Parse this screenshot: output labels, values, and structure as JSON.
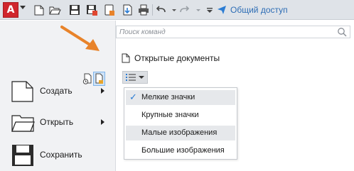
{
  "app": {
    "logo_letter": "A",
    "share_label": "Общий доступ"
  },
  "toolbar": {
    "icons": [
      "new-icon",
      "open-icon",
      "save-icon",
      "save-as-icon",
      "publish-icon",
      "import-icon",
      "print-icon",
      "undo-icon",
      "redo-icon",
      "customize-icon",
      "share-icon"
    ]
  },
  "search": {
    "placeholder": "Поиск команд"
  },
  "left_menu": {
    "items": [
      {
        "label": "Создать",
        "icon": "new-document-icon",
        "has_submenu": true
      },
      {
        "label": "Открыть",
        "icon": "folder-icon",
        "has_submenu": true
      },
      {
        "label": "Сохранить",
        "icon": "floppy-disk-icon",
        "has_submenu": false
      }
    ]
  },
  "mode_icons": [
    "recent-documents-icon",
    "open-documents-icon"
  ],
  "documents": {
    "title": "Открытые документы"
  },
  "view_dropdown": {
    "items": [
      {
        "label": "Мелкие значки",
        "checked": true
      },
      {
        "label": "Крупные значки",
        "checked": false
      },
      {
        "label": "Малые изображения",
        "checked": false
      },
      {
        "label": "Большие изображения",
        "checked": false
      }
    ]
  },
  "colors": {
    "accent": "#2b7cd3",
    "logo": "#d0262d",
    "annotation_arrow": "#e8832a"
  }
}
